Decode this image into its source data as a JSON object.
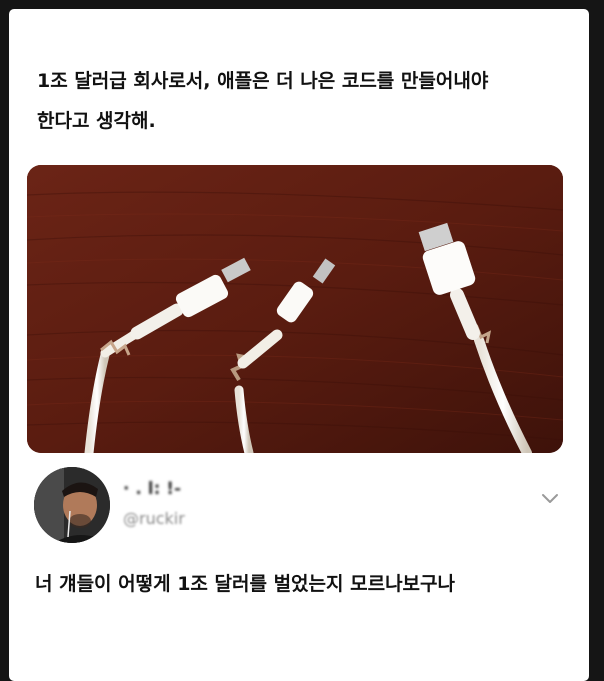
{
  "tweet": {
    "line1": "1조 달러급 회사로서, 애플은 더 나은 코드를 만들어내야",
    "line2": "한다고 생각해."
  },
  "reply": {
    "name": "· . l: !-",
    "handle": "@ruckir",
    "text": "너 걔들이 어떻게 1조 달러를 벌었는지 모르나보구나"
  },
  "colors": {
    "background": "#151515",
    "card": "#ffffff",
    "wood": "#5a1b10"
  },
  "icons": {
    "more": "chevron-down-icon"
  }
}
